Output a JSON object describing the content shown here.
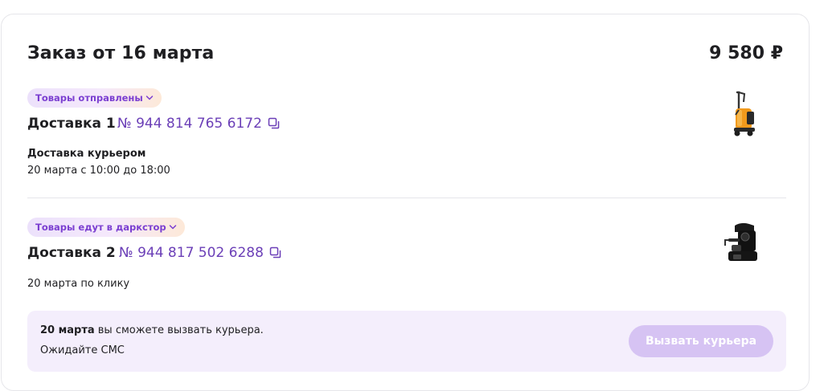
{
  "order": {
    "title": "Заказ от 16 марта",
    "total": "9 580 ₽"
  },
  "deliveries": [
    {
      "status": "Товары отправлены",
      "label": "Доставка 1",
      "number": "№ 944 814 765 6172",
      "method": "Доставка курьером",
      "date": "20 марта с 10:00 до 18:00",
      "product_icon": "pressure-washer-icon"
    },
    {
      "status": "Товары едут в даркстор",
      "label": "Доставка 2",
      "number": "№ 944 817 502 6288",
      "date": "20 марта по клику",
      "product_icon": "coffee-machine-icon"
    }
  ],
  "notice": {
    "date_bold": "20 марта",
    "text": " вы сможете вызвать курьера.",
    "sub": "Ожидайте СМС",
    "button_label": "Вызвать курьера"
  },
  "colors": {
    "accent": "#6b3fb7",
    "chip_text": "#7b3fd1",
    "notice_bg": "#f4eefc",
    "button_disabled": "#d6c3f3"
  }
}
